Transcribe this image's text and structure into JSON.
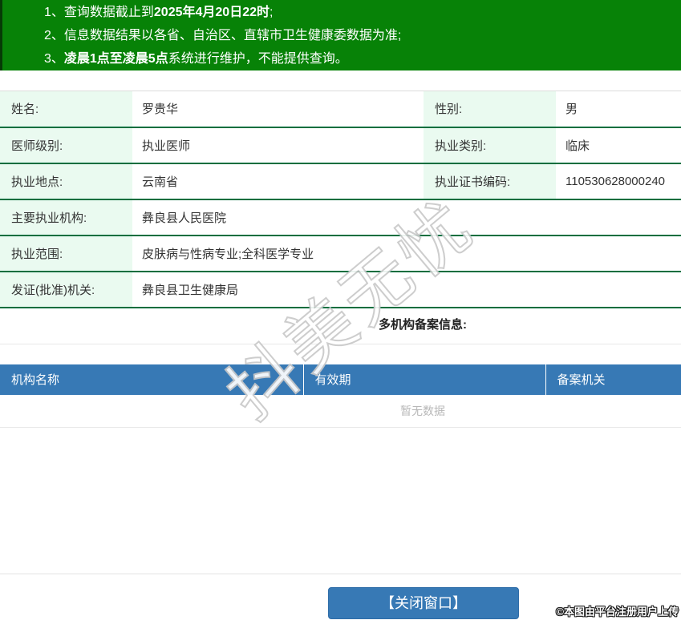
{
  "notice": {
    "lines": [
      {
        "pre": "1、查询数据截止到",
        "bold": "2025年4月20日22时",
        "post": ";"
      },
      {
        "pre": "2、信息数据结果以各省、自治区、直辖市卫生健康委数据为准;",
        "bold": "",
        "post": ""
      },
      {
        "pre": "3、",
        "bold": "凌晨1点至凌晨5点",
        "post": "系统进行维护，不能提供查询。"
      }
    ]
  },
  "info": {
    "rows2col": [
      {
        "l1": "姓名:",
        "v1": "罗贵华",
        "l2": "性别:",
        "v2": "男"
      },
      {
        "l1": "医师级别:",
        "v1": "执业医师",
        "l2": "执业类别:",
        "v2": "临床"
      },
      {
        "l1": "执业地点:",
        "v1": "云南省",
        "l2": "执业证书编码:",
        "v2": "110530628000240"
      }
    ],
    "rows1col": [
      {
        "l": "主要执业机构:",
        "v": "彝良县人民医院"
      },
      {
        "l": "执业范围:",
        "v": "皮肤病与性病专业;全科医学专业"
      },
      {
        "l": "发证(批准)机关:",
        "v": "彝良县卫生健康局"
      }
    ]
  },
  "records": {
    "title": "多机构备案信息:",
    "columns": [
      "机构名称",
      "有效期",
      "备案机关"
    ],
    "empty_text": "暂无数据"
  },
  "footer": {
    "close_button_label": "【关闭窗口】",
    "copyright": "©本图由平台注册用户上传"
  },
  "watermark_text": "抖美无忧",
  "colors": {
    "notice_green": "#078207",
    "label_cell_green": "#eafaf0",
    "row_border_green": "#006e3e",
    "table_header_blue": "#3779b5",
    "empty_text_grey": "#b8b8b8"
  }
}
